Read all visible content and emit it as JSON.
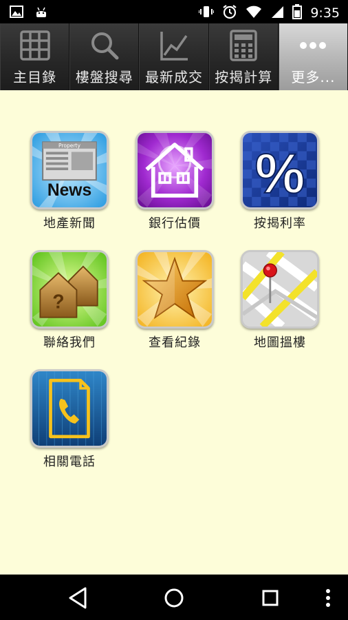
{
  "status_bar": {
    "time": "9:35",
    "left_icons": [
      "image-icon",
      "android-icon"
    ],
    "right_icons": [
      "vibrate-icon",
      "alarm-icon",
      "wifi-icon",
      "cellular-icon",
      "battery-icon"
    ]
  },
  "tabs": [
    {
      "label": "主目錄",
      "icon": "grid-icon",
      "active": false
    },
    {
      "label": "樓盤搜尋",
      "icon": "search-icon",
      "active": false
    },
    {
      "label": "最新成交",
      "icon": "chart-icon",
      "active": false
    },
    {
      "label": "按揭計算",
      "icon": "calculator-icon",
      "active": false
    },
    {
      "label": "更多...",
      "icon": "more-icon",
      "active": true
    }
  ],
  "apps": [
    {
      "label": "地產新聞",
      "icon": "news-icon",
      "icon_text": "News",
      "icon_subtext": "Property"
    },
    {
      "label": "銀行估價",
      "icon": "house-icon"
    },
    {
      "label": "按揭利率",
      "icon": "percent-icon",
      "icon_text": "%"
    },
    {
      "label": "聯絡我們",
      "icon": "contact-houses-icon",
      "icon_text": "?"
    },
    {
      "label": "查看紀錄",
      "icon": "star-icon"
    },
    {
      "label": "地圖搵樓",
      "icon": "map-pin-icon"
    },
    {
      "label": "相關電話",
      "icon": "phone-icon"
    }
  ],
  "nav_bar": {
    "icons": [
      "back-icon",
      "home-icon",
      "recents-icon",
      "overflow-menu-icon"
    ]
  },
  "colors": {
    "content_bg": "#fdfdd9",
    "tab_bg": "#2a2a2a",
    "tab_active_bg": "#b5b5b5"
  }
}
